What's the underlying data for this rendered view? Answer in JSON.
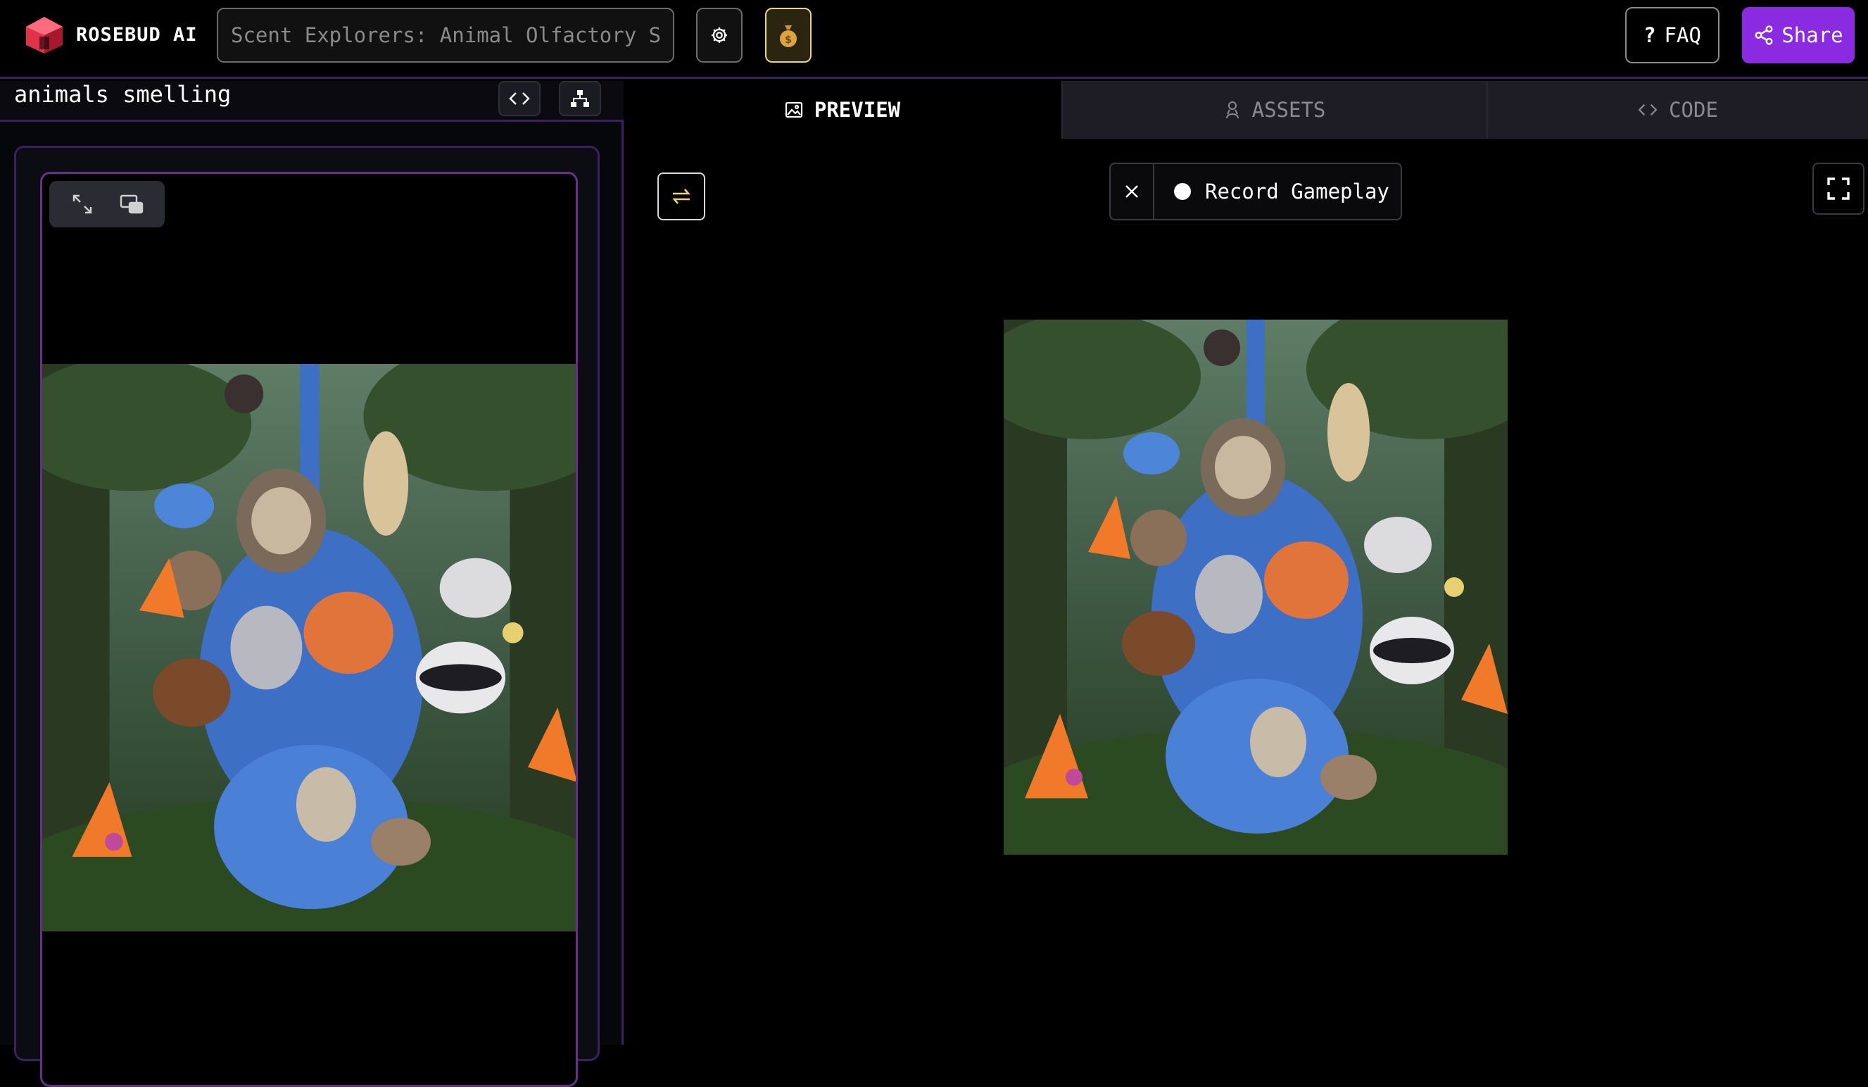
{
  "header": {
    "brand": "ROSEBUD AI",
    "title_placeholder": "Scent Explorers: Animal Olfactory S…",
    "faq_label": "FAQ",
    "share_label": "Share",
    "icons": {
      "logo": "rosebud-logo-icon",
      "settings": "gear-icon",
      "credits": "money-bag-icon",
      "faq": "question-mark-icon",
      "share": "share-icon"
    }
  },
  "left_panel": {
    "title": "animals smelling",
    "icons": [
      "code-icon",
      "sitemap-icon",
      "expand-icon",
      "picture-in-picture-icon"
    ]
  },
  "tabs": [
    {
      "label": "PREVIEW",
      "icon": "image-icon",
      "active": true
    },
    {
      "label": "ASSETS",
      "icon": "assets-icon",
      "active": false
    },
    {
      "label": "CODE",
      "icon": "code-icon",
      "active": false
    }
  ],
  "stage": {
    "record_label": "Record Gameplay",
    "icons": [
      "loop-icon",
      "close-icon",
      "record-dot-icon",
      "fullscreen-icon"
    ]
  },
  "game_image": {
    "description_icon": "jungle-animal-scene",
    "colors": {
      "sky": "#4e6a58",
      "foliage": "#2f4a2a",
      "snake": "#3d6fc4",
      "fox": "#e0743a",
      "flower": "#f07a2a"
    }
  },
  "colors": {
    "accent": "#8a2be2",
    "border_purple": "#3b1f5e",
    "frame_purple": "#6a2d8e",
    "logo_red": "#e0334a",
    "money_border": "#e8d77a"
  }
}
